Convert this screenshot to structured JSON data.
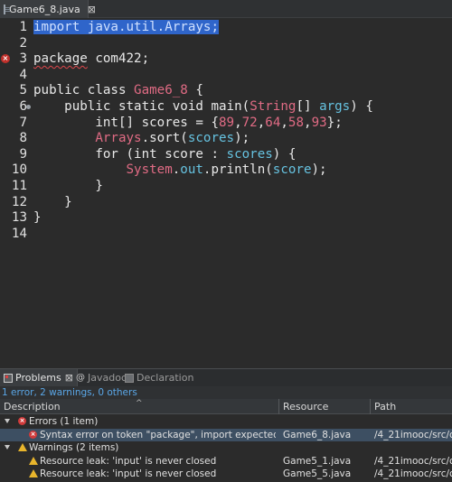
{
  "editor_tab": {
    "title": "Game6_8.java",
    "close": "⊠"
  },
  "code": {
    "lines": [
      {
        "n": "1",
        "parts": [
          {
            "t": "import java.util.Arrays;",
            "c": "sel"
          }
        ]
      },
      {
        "n": "2",
        "parts": []
      },
      {
        "n": "3",
        "marker": "error",
        "parts": [
          {
            "t": "package",
            "c": "kw squiggle"
          },
          {
            "t": " com422;",
            "c": "var"
          }
        ]
      },
      {
        "n": "4",
        "parts": []
      },
      {
        "n": "5",
        "parts": [
          {
            "t": "public class ",
            "c": "kw"
          },
          {
            "t": "Game6_8",
            "c": "type-cls"
          },
          {
            "t": " {",
            "c": "var"
          }
        ]
      },
      {
        "n": "6",
        "fold": true,
        "parts": [
          {
            "t": "    public static void ",
            "c": "kw"
          },
          {
            "t": "main",
            "c": "var"
          },
          {
            "t": "(",
            "c": "var"
          },
          {
            "t": "String",
            "c": "type-cls"
          },
          {
            "t": "[] ",
            "c": "var"
          },
          {
            "t": "args",
            "c": "fld"
          },
          {
            "t": ") {",
            "c": "var"
          }
        ]
      },
      {
        "n": "7",
        "parts": [
          {
            "t": "        int[] scores = {",
            "c": "var"
          },
          {
            "t": "89",
            "c": "num"
          },
          {
            "t": ",",
            "c": "var"
          },
          {
            "t": "72",
            "c": "num"
          },
          {
            "t": ",",
            "c": "var"
          },
          {
            "t": "64",
            "c": "num"
          },
          {
            "t": ",",
            "c": "var"
          },
          {
            "t": "58",
            "c": "num"
          },
          {
            "t": ",",
            "c": "var"
          },
          {
            "t": "93",
            "c": "num"
          },
          {
            "t": "};",
            "c": "var"
          }
        ]
      },
      {
        "n": "8",
        "parts": [
          {
            "t": "        ",
            "c": "var"
          },
          {
            "t": "Arrays",
            "c": "type-cls"
          },
          {
            "t": ".sort(",
            "c": "var"
          },
          {
            "t": "scores",
            "c": "fld"
          },
          {
            "t": ");",
            "c": "var"
          }
        ]
      },
      {
        "n": "9",
        "parts": [
          {
            "t": "        for (int score : ",
            "c": "kw"
          },
          {
            "t": "scores",
            "c": "fld"
          },
          {
            "t": ") {",
            "c": "var"
          }
        ]
      },
      {
        "n": "10",
        "parts": [
          {
            "t": "            ",
            "c": "var"
          },
          {
            "t": "System",
            "c": "type-cls"
          },
          {
            "t": ".",
            "c": "var"
          },
          {
            "t": "out",
            "c": "fld"
          },
          {
            "t": ".println(",
            "c": "var"
          },
          {
            "t": "score",
            "c": "fld"
          },
          {
            "t": ");",
            "c": "var"
          }
        ]
      },
      {
        "n": "11",
        "parts": [
          {
            "t": "        }",
            "c": "var"
          }
        ]
      },
      {
        "n": "12",
        "parts": [
          {
            "t": "    }",
            "c": "var"
          }
        ]
      },
      {
        "n": "13",
        "parts": [
          {
            "t": "}",
            "c": "var"
          }
        ]
      },
      {
        "n": "14",
        "parts": []
      }
    ]
  },
  "panel": {
    "tabs": {
      "problems": "Problems",
      "problems_close": "⊠",
      "javadoc": "Javadoc",
      "declaration": "Declaration"
    },
    "summary": "1 error, 2 warnings, 0 others",
    "columns": {
      "description": "Description",
      "resource": "Resource",
      "path": "Path"
    },
    "rows": [
      {
        "kind": "group-error",
        "description": "Errors (1 item)",
        "resource": "",
        "path": ""
      },
      {
        "kind": "error",
        "description": "Syntax error on token \"package\", import expected",
        "resource": "Game6_8.java",
        "path": "/4_21imooc/src/c..."
      },
      {
        "kind": "group-warning",
        "description": "Warnings (2 items)",
        "resource": "",
        "path": ""
      },
      {
        "kind": "warning",
        "description": "Resource leak: 'input' is never closed",
        "resource": "Game5_1.java",
        "path": "/4_21imooc/src/c..."
      },
      {
        "kind": "warning",
        "description": "Resource leak: 'input' is never closed",
        "resource": "Game5_5.java",
        "path": "/4_21imooc/src/c..."
      }
    ]
  }
}
